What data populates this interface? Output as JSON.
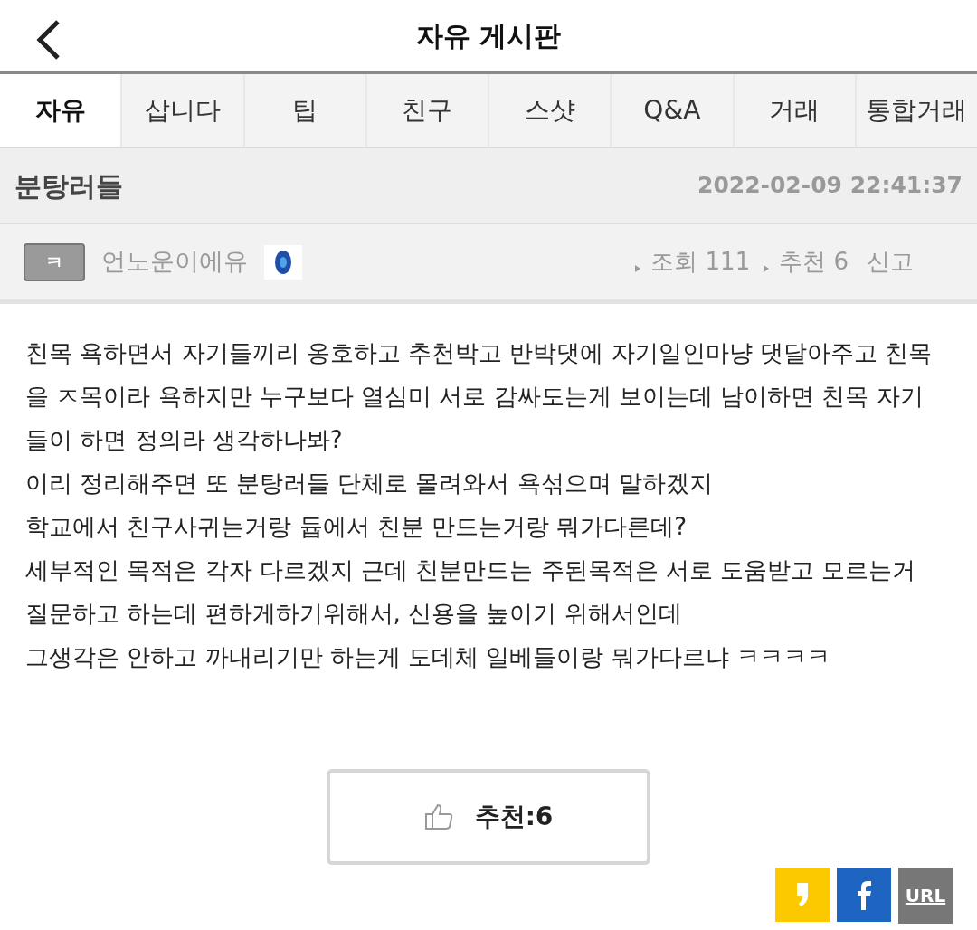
{
  "header": {
    "title": "자유 게시판"
  },
  "tabs": [
    {
      "label": "자유",
      "selected": true
    },
    {
      "label": "삽니다",
      "selected": false
    },
    {
      "label": "팁",
      "selected": false
    },
    {
      "label": "친구",
      "selected": false
    },
    {
      "label": "스샷",
      "selected": false
    },
    {
      "label": "Q&A",
      "selected": false
    },
    {
      "label": "거래",
      "selected": false
    },
    {
      "label": "통합거래",
      "selected": false
    }
  ],
  "post": {
    "title": "분탕러들",
    "date": "2022-02-09 22:41:37",
    "level_badge": "ㅋ",
    "author": "언노운이에유",
    "views": "조회 111",
    "likes": "추천 6",
    "report": "신고",
    "body": [
      "친목 욕하면서 자기들끼리 옹호하고 추천박고 반박댓에 자기일인마냥 댓달아주고 친목",
      "을 ㅈ목이라 욕하지만 누구보다 열심미 서로 감싸도는게 보이는데 남이하면 친목 자기",
      "들이 하면 정의라 생각하나봐?",
      "이리 정리해주면 또 분탕러들 단체로 몰려와서 욕섞으며 말하겠지",
      "학교에서 친구사귀는거랑 듑에서 친분 만드는거랑 뭐가다른데?",
      "세부적인 목적은 각자 다르겠지 근데 친분만드는 주된목적은 서로 도움받고 모르는거",
      "질문하고 하는데 편하게하기위해서, 신용을 높이기 위해서인데",
      "그생각은 안하고 까내리기만 하는게 도데체 일베들이랑 뭐가다르냐 ㅋㅋㅋㅋ"
    ],
    "recommend_button": "추천:6"
  },
  "share": [
    {
      "kind": "kakao"
    },
    {
      "kind": "facebook"
    },
    {
      "kind": "url",
      "label": "URL"
    }
  ]
}
